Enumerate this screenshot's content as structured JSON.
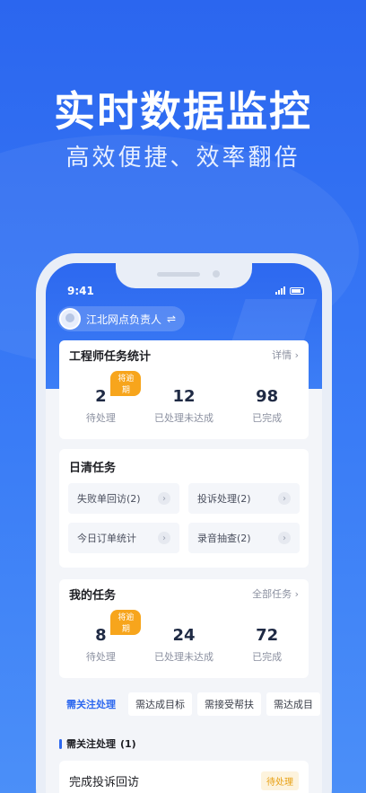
{
  "promo": {
    "headline": "实时数据监控",
    "subline": "高效便捷、效率翻倍"
  },
  "status_bar": {
    "time": "9:41"
  },
  "header": {
    "role_label": "江北网点负责人",
    "switch_icon": "⇌"
  },
  "engineer_stats": {
    "title": "工程师任务统计",
    "detail_link": "详情 ›",
    "overdue_badge": "将逾期",
    "items": [
      {
        "value": "2",
        "label": "待处理"
      },
      {
        "value": "12",
        "label": "已处理未达成"
      },
      {
        "value": "98",
        "label": "已完成"
      }
    ]
  },
  "daily_tasks": {
    "title": "日清任务",
    "items": [
      {
        "label": "失败单回访(2)"
      },
      {
        "label": "投诉处理(2)"
      },
      {
        "label": "今日订单统计"
      },
      {
        "label": "录音抽查(2)"
      }
    ]
  },
  "my_tasks": {
    "title": "我的任务",
    "all_link": "全部任务 ›",
    "overdue_badge": "将逾期",
    "items": [
      {
        "value": "8",
        "label": "待处理"
      },
      {
        "value": "24",
        "label": "已处理未达成"
      },
      {
        "value": "72",
        "label": "已完成"
      }
    ]
  },
  "tabs": [
    "需关注处理",
    "需达成目标",
    "需接受帮扶",
    "需达成目"
  ],
  "section": {
    "title": "需关注处理",
    "count": "(1)"
  },
  "todo": {
    "title": "完成投诉回访",
    "status": "待处理"
  },
  "icons": {
    "arrow": "›",
    "accent": "#2d68ef",
    "warning": "#f7a51c"
  }
}
